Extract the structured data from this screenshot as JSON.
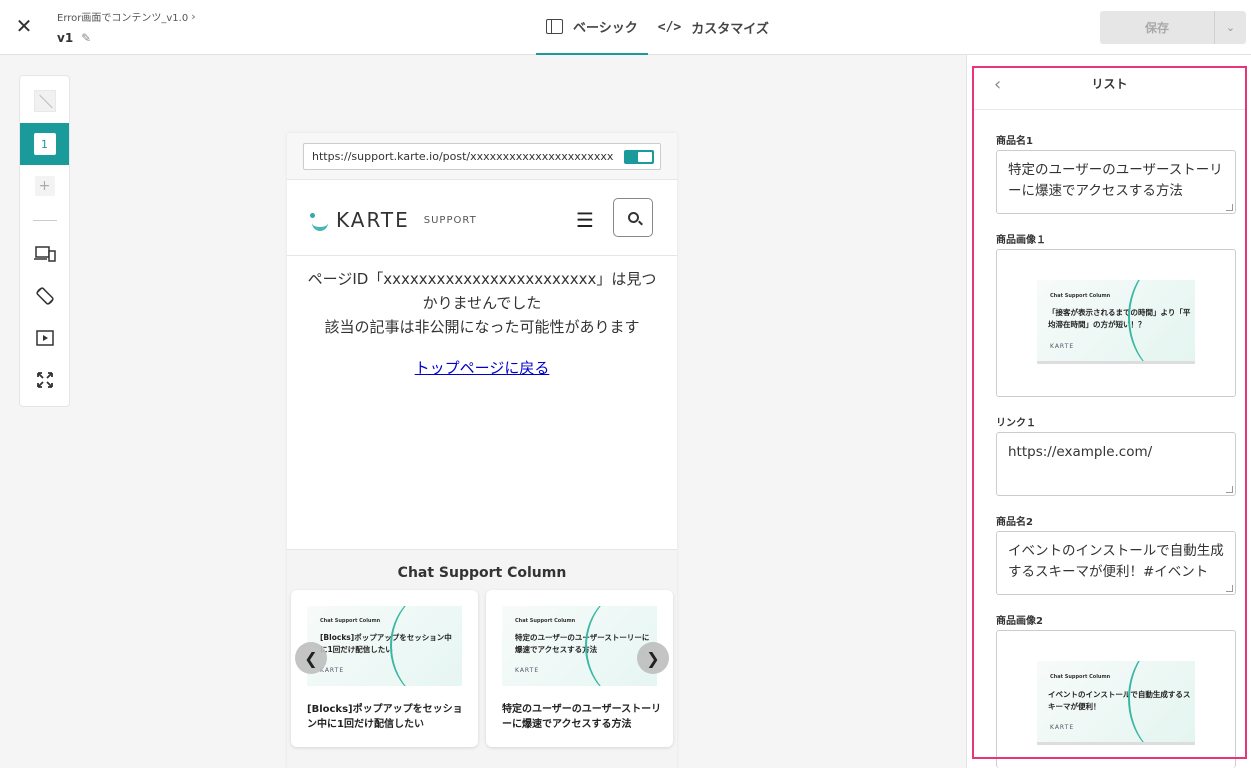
{
  "header": {
    "breadcrumb": "Error画面でコンテンツ_v1.0",
    "version": "v1",
    "tabs": [
      {
        "label": "ベーシック",
        "icon": "book-icon",
        "active": true
      },
      {
        "label": "カスタマイズ",
        "icon": "code-icon",
        "active": false
      }
    ],
    "save_label": "保存"
  },
  "toolbar": {
    "active_page": "1"
  },
  "preview": {
    "url": "https://support.karte.io/post/xxxxxxxxxxxxxxxxxxxxxxxxx",
    "logo_text": "KARTE",
    "logo_sub": "SUPPORT",
    "error_line1": "ページID「xxxxxxxxxxxxxxxxxxxxxxxx」は見つかりませんでした",
    "error_line2": "該当の記事は非公開になった可能性があります",
    "top_link": "トップページに戻る",
    "column_title": "Chat Support Column",
    "cards": [
      {
        "image_label": "Chat Support Column",
        "image_heading": "[Blocks]ポップアップをセッション中に1回だけ配信したい",
        "image_logo": "KARTE",
        "title": "[Blocks]ポップアップをセッション中に1回だけ配信したい"
      },
      {
        "image_label": "Chat Support Column",
        "image_heading": "特定のユーザーのユーザーストーリーに爆速でアクセスする方法",
        "image_logo": "KARTE",
        "title": "特定のユーザーのユーザーストーリーに爆速でアクセスする方法"
      }
    ]
  },
  "panel": {
    "title": "リスト",
    "fields": {
      "name1_label": "商品名1",
      "name1_value": "特定のユーザーのユーザーストーリーに爆速でアクセスする方法",
      "image1_label": "商品画像１",
      "image1_thumb_label": "Chat Support Column",
      "image1_thumb_heading": "「接客が表示されるまでの時間」より「平均滞在時間」の方が短い！？",
      "image1_thumb_logo": "KARTE",
      "link1_label": "リンク１",
      "link1_value": "https://example.com/",
      "name2_label": "商品名2",
      "name2_value": "イベントのインストールで自動生成するスキーマが便利！#イベント",
      "image2_label": "商品画像2",
      "image2_thumb_label": "Chat Support Column",
      "image2_thumb_heading": "イベントのインストールで自動生成するスキーマが便利！",
      "image2_thumb_logo": "KARTE"
    }
  },
  "colors": {
    "accent": "#1a9a9a",
    "highlight": "#e83479",
    "link": "#0000cc"
  }
}
